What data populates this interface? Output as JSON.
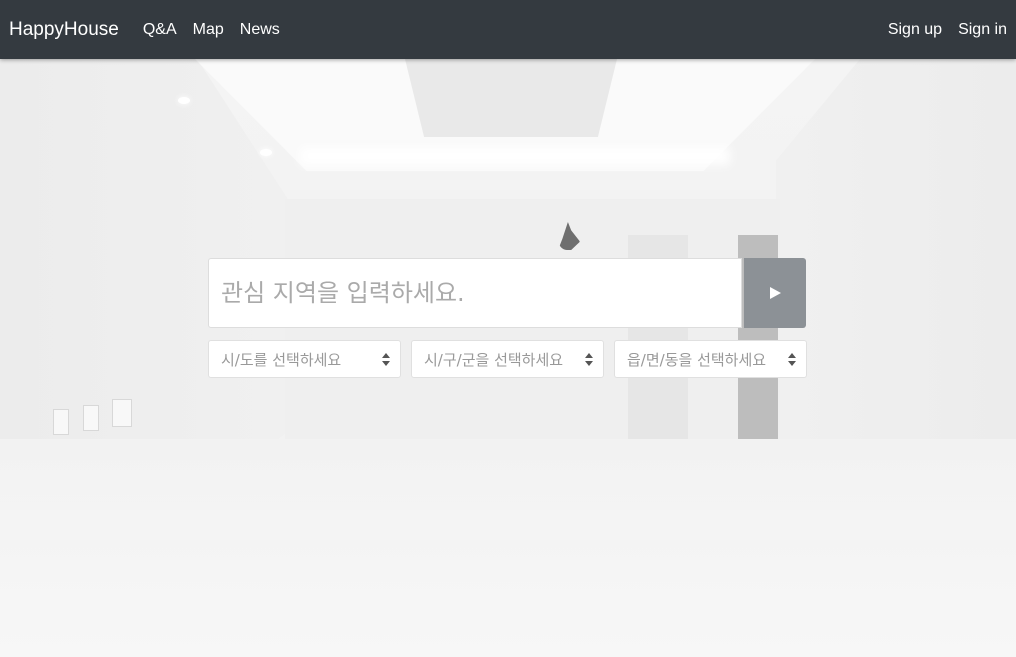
{
  "navbar": {
    "brand": "HappyHouse",
    "links": [
      "Q&A",
      "Map",
      "News"
    ],
    "right_links": [
      "Sign up",
      "Sign in"
    ],
    "background_color": "#343a40"
  },
  "search": {
    "placeholder": "관심 지역을 입력하세요.",
    "value": "",
    "button_icon": "play-icon",
    "button_color": "#8c9196"
  },
  "selects": {
    "sido": "시/도를 선택하세요",
    "gugun": "시/구/군을 선택하세요",
    "dong": "읍/면/동을 선택하세요"
  }
}
